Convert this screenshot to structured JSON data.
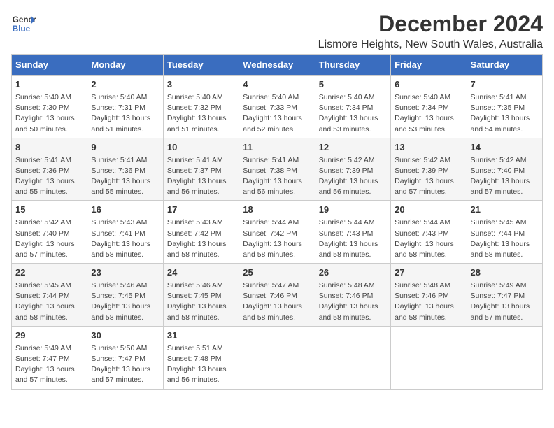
{
  "logo": {
    "line1": "General",
    "line2": "Blue"
  },
  "title": "December 2024",
  "subtitle": "Lismore Heights, New South Wales, Australia",
  "days_of_week": [
    "Sunday",
    "Monday",
    "Tuesday",
    "Wednesday",
    "Thursday",
    "Friday",
    "Saturday"
  ],
  "weeks": [
    [
      {
        "day": "1",
        "info": "Sunrise: 5:40 AM\nSunset: 7:30 PM\nDaylight: 13 hours\nand 50 minutes."
      },
      {
        "day": "2",
        "info": "Sunrise: 5:40 AM\nSunset: 7:31 PM\nDaylight: 13 hours\nand 51 minutes."
      },
      {
        "day": "3",
        "info": "Sunrise: 5:40 AM\nSunset: 7:32 PM\nDaylight: 13 hours\nand 51 minutes."
      },
      {
        "day": "4",
        "info": "Sunrise: 5:40 AM\nSunset: 7:33 PM\nDaylight: 13 hours\nand 52 minutes."
      },
      {
        "day": "5",
        "info": "Sunrise: 5:40 AM\nSunset: 7:34 PM\nDaylight: 13 hours\nand 53 minutes."
      },
      {
        "day": "6",
        "info": "Sunrise: 5:40 AM\nSunset: 7:34 PM\nDaylight: 13 hours\nand 53 minutes."
      },
      {
        "day": "7",
        "info": "Sunrise: 5:41 AM\nSunset: 7:35 PM\nDaylight: 13 hours\nand 54 minutes."
      }
    ],
    [
      {
        "day": "8",
        "info": "Sunrise: 5:41 AM\nSunset: 7:36 PM\nDaylight: 13 hours\nand 55 minutes."
      },
      {
        "day": "9",
        "info": "Sunrise: 5:41 AM\nSunset: 7:36 PM\nDaylight: 13 hours\nand 55 minutes."
      },
      {
        "day": "10",
        "info": "Sunrise: 5:41 AM\nSunset: 7:37 PM\nDaylight: 13 hours\nand 56 minutes."
      },
      {
        "day": "11",
        "info": "Sunrise: 5:41 AM\nSunset: 7:38 PM\nDaylight: 13 hours\nand 56 minutes."
      },
      {
        "day": "12",
        "info": "Sunrise: 5:42 AM\nSunset: 7:39 PM\nDaylight: 13 hours\nand 56 minutes."
      },
      {
        "day": "13",
        "info": "Sunrise: 5:42 AM\nSunset: 7:39 PM\nDaylight: 13 hours\nand 57 minutes."
      },
      {
        "day": "14",
        "info": "Sunrise: 5:42 AM\nSunset: 7:40 PM\nDaylight: 13 hours\nand 57 minutes."
      }
    ],
    [
      {
        "day": "15",
        "info": "Sunrise: 5:42 AM\nSunset: 7:40 PM\nDaylight: 13 hours\nand 57 minutes."
      },
      {
        "day": "16",
        "info": "Sunrise: 5:43 AM\nSunset: 7:41 PM\nDaylight: 13 hours\nand 58 minutes."
      },
      {
        "day": "17",
        "info": "Sunrise: 5:43 AM\nSunset: 7:42 PM\nDaylight: 13 hours\nand 58 minutes."
      },
      {
        "day": "18",
        "info": "Sunrise: 5:44 AM\nSunset: 7:42 PM\nDaylight: 13 hours\nand 58 minutes."
      },
      {
        "day": "19",
        "info": "Sunrise: 5:44 AM\nSunset: 7:43 PM\nDaylight: 13 hours\nand 58 minutes."
      },
      {
        "day": "20",
        "info": "Sunrise: 5:44 AM\nSunset: 7:43 PM\nDaylight: 13 hours\nand 58 minutes."
      },
      {
        "day": "21",
        "info": "Sunrise: 5:45 AM\nSunset: 7:44 PM\nDaylight: 13 hours\nand 58 minutes."
      }
    ],
    [
      {
        "day": "22",
        "info": "Sunrise: 5:45 AM\nSunset: 7:44 PM\nDaylight: 13 hours\nand 58 minutes."
      },
      {
        "day": "23",
        "info": "Sunrise: 5:46 AM\nSunset: 7:45 PM\nDaylight: 13 hours\nand 58 minutes."
      },
      {
        "day": "24",
        "info": "Sunrise: 5:46 AM\nSunset: 7:45 PM\nDaylight: 13 hours\nand 58 minutes."
      },
      {
        "day": "25",
        "info": "Sunrise: 5:47 AM\nSunset: 7:46 PM\nDaylight: 13 hours\nand 58 minutes."
      },
      {
        "day": "26",
        "info": "Sunrise: 5:48 AM\nSunset: 7:46 PM\nDaylight: 13 hours\nand 58 minutes."
      },
      {
        "day": "27",
        "info": "Sunrise: 5:48 AM\nSunset: 7:46 PM\nDaylight: 13 hours\nand 58 minutes."
      },
      {
        "day": "28",
        "info": "Sunrise: 5:49 AM\nSunset: 7:47 PM\nDaylight: 13 hours\nand 57 minutes."
      }
    ],
    [
      {
        "day": "29",
        "info": "Sunrise: 5:49 AM\nSunset: 7:47 PM\nDaylight: 13 hours\nand 57 minutes."
      },
      {
        "day": "30",
        "info": "Sunrise: 5:50 AM\nSunset: 7:47 PM\nDaylight: 13 hours\nand 57 minutes."
      },
      {
        "day": "31",
        "info": "Sunrise: 5:51 AM\nSunset: 7:48 PM\nDaylight: 13 hours\nand 56 minutes."
      },
      {
        "day": "",
        "info": ""
      },
      {
        "day": "",
        "info": ""
      },
      {
        "day": "",
        "info": ""
      },
      {
        "day": "",
        "info": ""
      }
    ]
  ]
}
